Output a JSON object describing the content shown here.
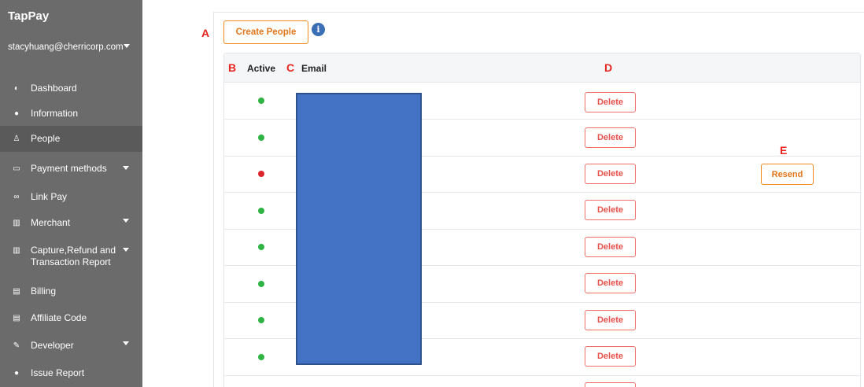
{
  "sidebar": {
    "brand": "TapPay",
    "account": "stacyhuang@cherricorp.com",
    "items": [
      {
        "label": "Dashboard",
        "icon": "dashboard-icon",
        "active": false,
        "has_caret": false
      },
      {
        "label": "Information",
        "icon": "info-circle-icon",
        "active": false,
        "has_caret": false
      },
      {
        "label": "People",
        "icon": "people-icon",
        "active": true,
        "has_caret": false
      },
      {
        "label": "Payment methods",
        "icon": "credit-card-icon",
        "active": false,
        "has_caret": true
      },
      {
        "label": "Link Pay",
        "icon": "link-icon",
        "active": false,
        "has_caret": false
      },
      {
        "label": "Merchant",
        "icon": "building-icon",
        "active": false,
        "has_caret": true
      },
      {
        "label": "Capture,Refund and Transaction Report",
        "icon": "building-icon",
        "active": false,
        "has_caret": true
      },
      {
        "label": "Billing",
        "icon": "document-icon",
        "active": false,
        "has_caret": false
      },
      {
        "label": "Affiliate Code",
        "icon": "document-icon",
        "active": false,
        "has_caret": false
      },
      {
        "label": "Developer",
        "icon": "wrench-icon",
        "active": false,
        "has_caret": true
      },
      {
        "label": "Issue Report",
        "icon": "question-icon",
        "active": false,
        "has_caret": false
      }
    ]
  },
  "annotations": {
    "a": "A",
    "b": "B",
    "c": "C",
    "d": "D",
    "e": "E"
  },
  "toolbar": {
    "create_label": "Create People",
    "info_icon": "info-icon"
  },
  "table": {
    "headers": {
      "active": "Active",
      "email": "Email"
    },
    "rows": [
      {
        "active": true,
        "status_color": "#2fb344",
        "delete_label": "Delete",
        "resend_label": null
      },
      {
        "active": true,
        "status_color": "#2fb344",
        "delete_label": "Delete",
        "resend_label": null
      },
      {
        "active": false,
        "status_color": "#d9262a",
        "delete_label": "Delete",
        "resend_label": "Resend"
      },
      {
        "active": true,
        "status_color": "#2fb344",
        "delete_label": "Delete",
        "resend_label": null
      },
      {
        "active": true,
        "status_color": "#2fb344",
        "delete_label": "Delete",
        "resend_label": null
      },
      {
        "active": true,
        "status_color": "#2fb344",
        "delete_label": "Delete",
        "resend_label": null
      },
      {
        "active": true,
        "status_color": "#2fb344",
        "delete_label": "Delete",
        "resend_label": null
      },
      {
        "active": true,
        "status_color": "#2fb344",
        "delete_label": "Delete",
        "resend_label": null
      }
    ]
  },
  "colors": {
    "sidebar_bg": "#6b6b6b",
    "accent_orange": "#f08a1e",
    "delete_red": "#ef6f6a",
    "annotation_red": "#e8231e",
    "redaction_blue": "#4472c4"
  }
}
